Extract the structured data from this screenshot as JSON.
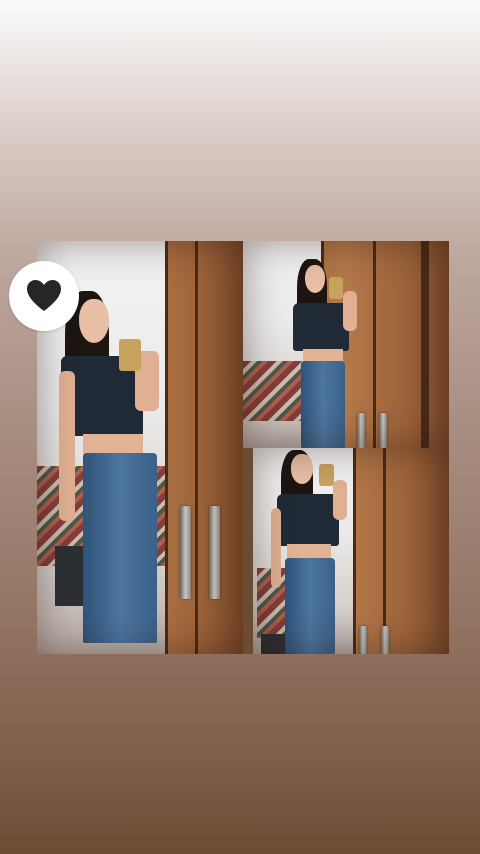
{
  "story": {
    "background_top_color": "#fbfbfb",
    "background_bottom_color": "#6e4b35"
  },
  "collage": {
    "photo_count": 3,
    "subject": "mirror selfie",
    "accent_colors": {
      "wood": "#a56c41",
      "top": "#1f2a36",
      "jeans": "#4d76a0"
    }
  },
  "sticker": {
    "icon": "black-heart-icon",
    "color": "#262626"
  }
}
